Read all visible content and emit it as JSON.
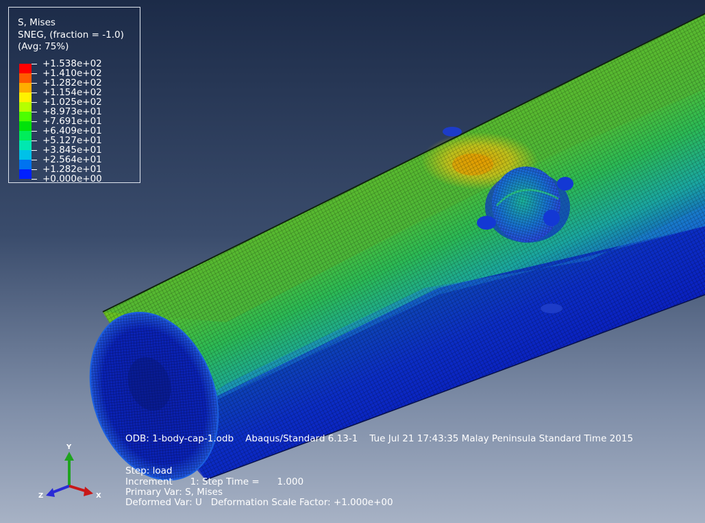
{
  "legend": {
    "title": "S, Mises",
    "subtitle": "SNEG, (fraction = -1.0)",
    "averaging": "(Avg: 75%)",
    "entries": [
      {
        "value": "+1.538e+02",
        "color": "#ff0000"
      },
      {
        "value": "+1.410e+02",
        "color": "#ff5b00"
      },
      {
        "value": "+1.282e+02",
        "color": "#ffae00"
      },
      {
        "value": "+1.154e+02",
        "color": "#fff200"
      },
      {
        "value": "+1.025e+02",
        "color": "#b6ff00"
      },
      {
        "value": "+8.973e+01",
        "color": "#4dff00"
      },
      {
        "value": "+7.691e+01",
        "color": "#00e20a"
      },
      {
        "value": "+6.409e+01",
        "color": "#00ed5a"
      },
      {
        "value": "+5.127e+01",
        "color": "#00e8b0"
      },
      {
        "value": "+3.845e+01",
        "color": "#00c1e8"
      },
      {
        "value": "+2.564e+01",
        "color": "#0073f0"
      },
      {
        "value": "+1.282e+01",
        "color": "#0020ff"
      },
      {
        "value": "+0.000e+00",
        "color": "#0000c8"
      }
    ]
  },
  "info": {
    "odb_line": "ODB: 1-body-cap-1.odb    Abaqus/Standard 6.13-1    Tue Jul 21 17:43:35 Malay Peninsula Standard Time 2015",
    "step_line": "Step: load",
    "increment_line": "Increment      1: Step Time =      1.000",
    "primary_var_line": "Primary Var: S, Mises",
    "deformed_var_line": "Deformed Var: U   Deformation Scale Factor: +1.000e+00"
  },
  "triad": {
    "y_label": "Y",
    "z_label": "Z",
    "x_label": "X",
    "y_color": "#1fa31f",
    "z_color": "#2a2ad6",
    "x_color": "#c81818"
  }
}
